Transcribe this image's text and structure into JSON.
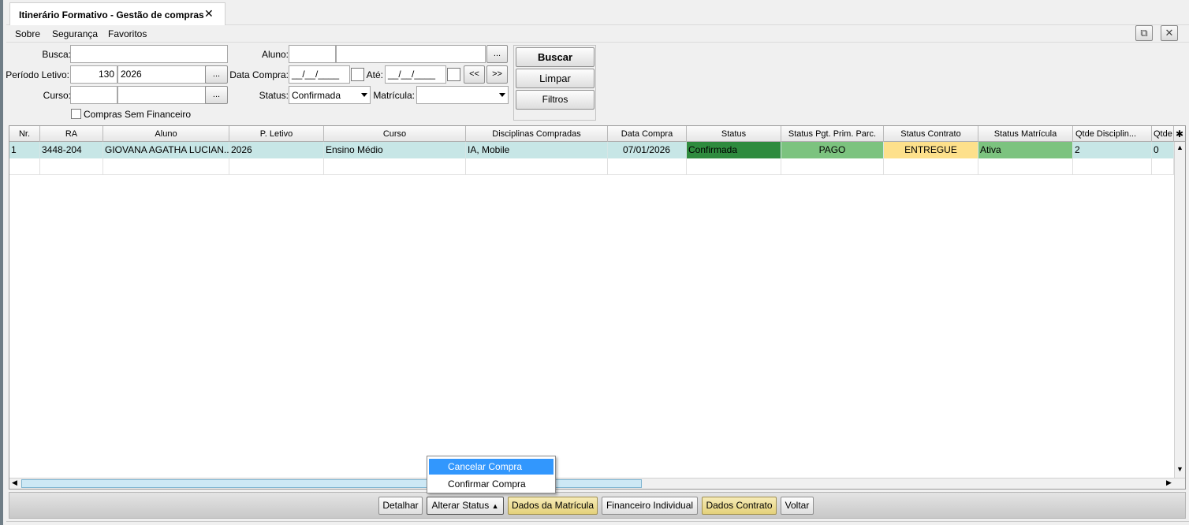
{
  "tab": {
    "title": "Itinerário Formativo - Gestão de compras",
    "close": "✕"
  },
  "menu": [
    "Sobre",
    "Segurança",
    "Favoritos"
  ],
  "window_buttons": {
    "popout": "⧉",
    "close": "✕"
  },
  "filters": {
    "busca_label": "Busca:",
    "aluno_label": "Aluno:",
    "periodo_label": "Período Letivo:",
    "periodo_code": "130",
    "periodo_year": "2026",
    "data_compra_label": "Data Compra:",
    "data_compra_value": "__/__/____",
    "ate_label": "Até:",
    "ate_value": "__/__/____",
    "prev": "<<",
    "next": ">>",
    "curso_label": "Curso:",
    "status_label": "Status:",
    "status_value": "Confirmada",
    "matricula_label": "Matrícula:",
    "matricula_value": "",
    "ellipsis": "...",
    "sem_financeiro": "Compras Sem Financeiro"
  },
  "buttons": {
    "buscar": "Buscar",
    "limpar": "Limpar",
    "filtros": "Filtros"
  },
  "grid": {
    "columns": [
      "Nr.",
      "RA",
      "Aluno",
      "P. Letivo",
      "Curso",
      "Disciplinas Compradas",
      "Data Compra",
      "Status",
      "Status Pgt. Prim. Parc.",
      "Status Contrato",
      "Status Matrícula",
      "Qtde Disciplin...",
      "Qtde"
    ],
    "rows": [
      {
        "nr": "1",
        "ra": "3448-204",
        "aluno": "GIOVANA AGATHA LUCIAN...",
        "letivo": "2026",
        "curso": "Ensino Médio",
        "disciplinas": "IA, Mobile",
        "data": "07/01/2026",
        "status": "Confirmada",
        "pgt": "PAGO",
        "contrato": "ENTREGUE",
        "matricula": "Ativa",
        "qtde_disc": "2",
        "qtde": "0"
      }
    ]
  },
  "colors": {
    "status_confirmada": "#2e8b3e",
    "pago": "#7cc37f",
    "entregue": "#fde08b",
    "ativa": "#7cc37f",
    "row_selected": "#c7e6e6"
  },
  "actions": {
    "detalhar": "Detalhar",
    "alterar_status": "Alterar Status",
    "dados_matricula": "Dados da Matrícula",
    "financeiro": "Financeiro Individual",
    "dados_contrato": "Dados Contrato",
    "voltar": "Voltar"
  },
  "popup": {
    "cancelar": "Cancelar Compra",
    "confirmar": "Confirmar Compra"
  }
}
